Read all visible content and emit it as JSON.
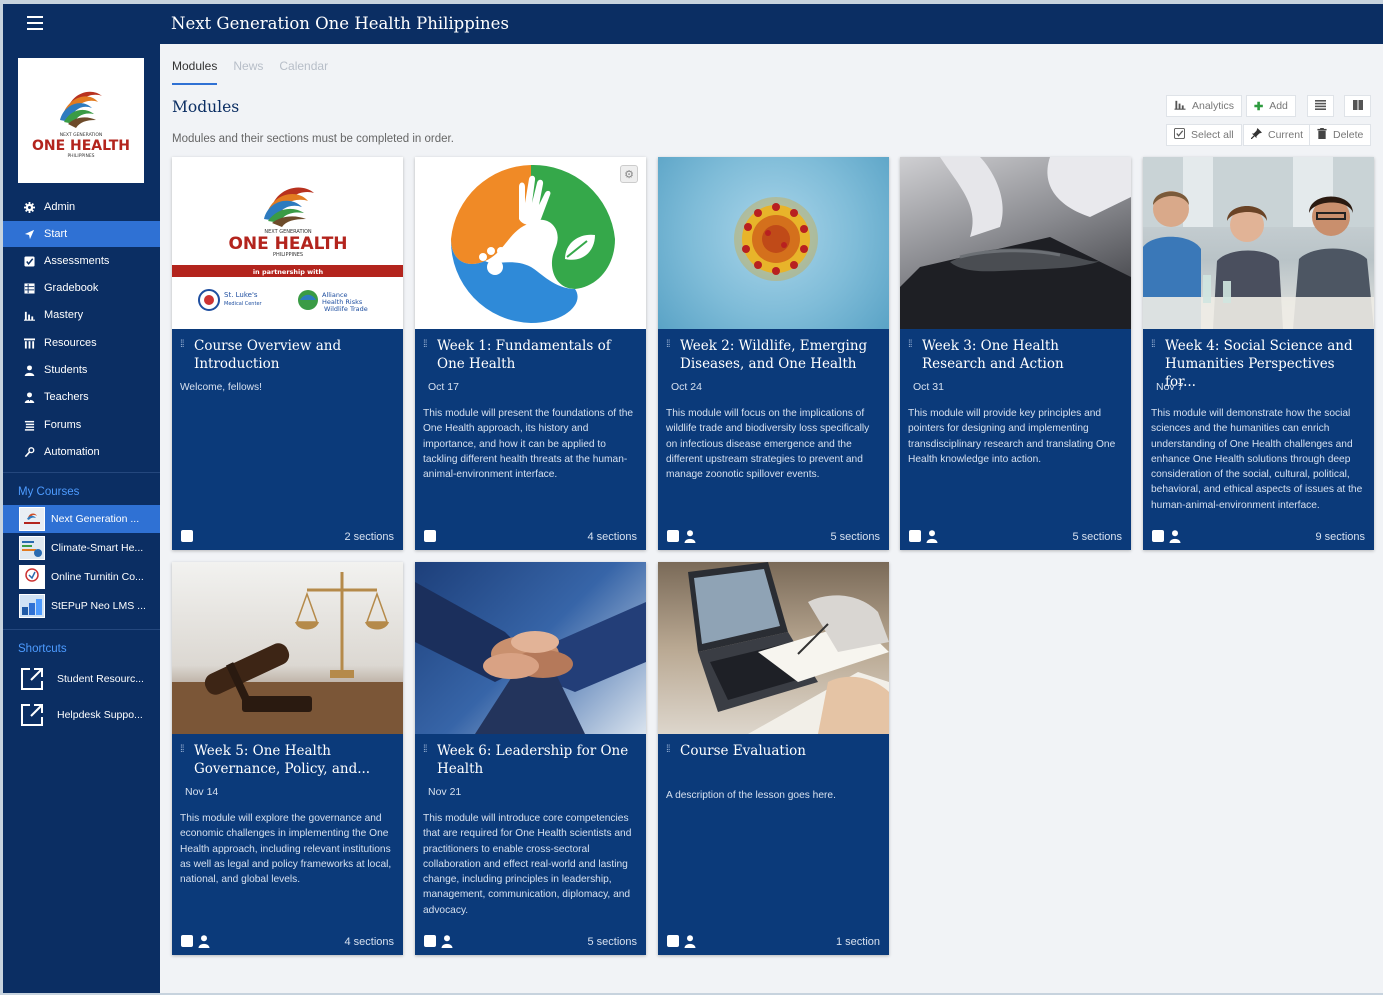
{
  "app": {
    "title": "Next Generation One Health Philippines"
  },
  "logo": {
    "line1": "NEXT GENERATION",
    "line2": "ONE HEALTH",
    "line3": "PHILIPPINES"
  },
  "nav": [
    {
      "label": "Admin",
      "icon": "gear-icon"
    },
    {
      "label": "Start",
      "icon": "navigation-arrow-icon"
    },
    {
      "label": "Assessments",
      "icon": "checkbox-icon"
    },
    {
      "label": "Gradebook",
      "icon": "gradebook-icon"
    },
    {
      "label": "Mastery",
      "icon": "bar-chart-icon"
    },
    {
      "label": "Resources",
      "icon": "library-icon"
    },
    {
      "label": "Students",
      "icon": "person-icon"
    },
    {
      "label": "Teachers",
      "icon": "teacher-icon"
    },
    {
      "label": "Forums",
      "icon": "forum-icon"
    },
    {
      "label": "Automation",
      "icon": "automation-icon"
    }
  ],
  "my_courses": {
    "heading": "My Courses",
    "items": [
      {
        "label": "Next Generation ..."
      },
      {
        "label": "Climate-Smart He..."
      },
      {
        "label": "Online Turnitin Co..."
      },
      {
        "label": "StEPuP Neo LMS ..."
      }
    ]
  },
  "shortcuts": {
    "heading": "Shortcuts",
    "items": [
      {
        "label": "Student Resourc..."
      },
      {
        "label": "Helpdesk Suppo..."
      }
    ]
  },
  "tabs": [
    "Modules",
    "News",
    "Calendar"
  ],
  "main": {
    "title": "Modules",
    "description": "Modules and their sections must be completed in order."
  },
  "toolbar": {
    "analytics": "Analytics",
    "add": "Add",
    "select_all": "Select all",
    "current": "Current",
    "delete": "Delete"
  },
  "cover": {
    "partnership": "in partnership with",
    "stlukes": "St. Luke's",
    "stlukes_sub": "Medical Center",
    "alliance": "Alliance",
    "alliance_sub1": "Health Risks",
    "alliance_sub2": "Wildlife Trade"
  },
  "cards": [
    {
      "title": "Course Overview and Introduction",
      "date": "",
      "desc": "Welcome, fellows!",
      "sections": "2 sections",
      "person": false
    },
    {
      "title": "Week 1: Fundamentals of One Health",
      "date": "Oct 17",
      "desc": "This module will present the foundations of the One Health approach, its history and importance, and how it can be applied to tackling different health threats at the human-animal-environment interface.",
      "sections": "4 sections",
      "person": false
    },
    {
      "title": "Week 2: Wildlife, Emerging Diseases, and One Health",
      "date": "Oct 24",
      "desc": "This module will focus on the implications of wildlife trade and biodiversity loss specifically on infectious disease emergence and the different upstream strategies to prevent and manage zoonotic spillover events.",
      "sections": "5 sections",
      "person": true
    },
    {
      "title": "Week 3: One Health Research and Action",
      "date": "Oct 31",
      "desc": "This module will provide key principles and pointers for designing and implementing transdisciplinary research and translating One Health knowledge into action.",
      "sections": "5 sections",
      "person": true
    },
    {
      "title": "Week 4: Social Science and Humanities Perspectives for...",
      "date": "Nov 7",
      "desc": "This module will demonstrate how the social sciences and the humanities can enrich understanding of One Health challenges and enhance One Health solutions through deep consideration of the social, cultural, political, behavioral, and ethical aspects of issues at the human-animal-environment interface.",
      "sections": "9 sections",
      "person": true
    },
    {
      "title": "Week 5: One Health Governance, Policy, and...",
      "date": "Nov 14",
      "desc": "This module will explore the governance and economic challenges in implementing the One Health approach, including relevant institutions as well as legal and policy frameworks at local, national, and global levels.",
      "sections": "4 sections",
      "person": true
    },
    {
      "title": "Week 6: Leadership for One Health",
      "date": "Nov 21",
      "desc": "This module will introduce core competencies that are required for One Health scientists and practitioners to enable cross-sectoral collaboration and effect real-world and lasting change, including principles in leadership, management, communication, diplomacy, and advocacy.",
      "sections": "5 sections",
      "person": true
    },
    {
      "title": "Course Evaluation",
      "date": "",
      "desc": "A description of the lesson goes here.",
      "sections": "1 section",
      "person": true
    }
  ]
}
